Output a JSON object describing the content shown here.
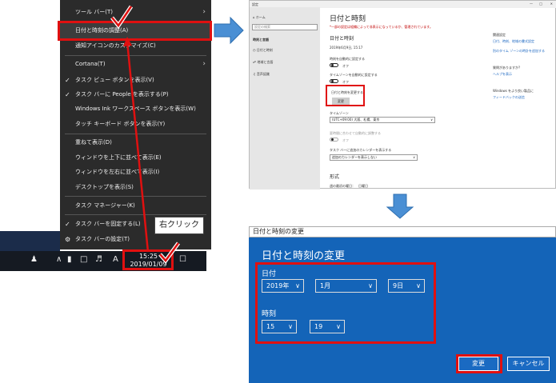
{
  "context_menu": {
    "items": [
      {
        "label": "ツール バー(T)",
        "arrow": "›"
      },
      {
        "label": "日付と時刻の調整(A)"
      },
      {
        "label": "通知アイコンのカスタマイズ(C)"
      },
      {
        "label": "Cortana(T)",
        "arrow": "›"
      },
      {
        "label": "タスク ビュー ボタンを表示(V)",
        "check": "✓"
      },
      {
        "label": "タスク バーに People を表示する(P)",
        "check": "✓"
      },
      {
        "label": "Windows Ink ワークスペース ボタンを表示(W)"
      },
      {
        "label": "タッチ キーボード ボタンを表示(Y)"
      },
      {
        "label": "重ねて表示(D)"
      },
      {
        "label": "ウィンドウを上下に並べて表示(E)"
      },
      {
        "label": "ウィンドウを左右に並べて表示(I)"
      },
      {
        "label": "デスクトップを表示(S)"
      },
      {
        "label": "タスク マネージャー(K)"
      },
      {
        "label": "タスク バーを固定する(L)",
        "check": "✓"
      },
      {
        "label": "タスク バーの設定(T)",
        "check": "⚙"
      }
    ]
  },
  "taskbar": {
    "time": "15:25",
    "date": "2019/01/09",
    "ime": "A"
  },
  "callout": {
    "label": "右クリック"
  },
  "settings": {
    "window_label": "設定",
    "search_placeholder": "設定の検索",
    "sidebar": {
      "home": "ホーム",
      "section": "時刻と言語",
      "items": [
        "日付と時刻",
        "地域と言語",
        "音声認識"
      ]
    },
    "title": "日付と時刻",
    "warning": "*一部の設定は組織によって非表示になっているか、管理されています。",
    "section_title": "日付と時刻",
    "current": "2019年6月9日, 15:17",
    "auto_time_label": "時刻を自動的に設定する",
    "auto_time_state": "オフ",
    "auto_tz_label": "タイムゾーンを自動的に設定する",
    "auto_tz_state": "オフ",
    "change_label": "日付と時刻を変更する",
    "change_button": "変更",
    "tz_label": "タイムゾーン",
    "tz_value": "(UTC+09:00) 大阪、札幌、東京",
    "dst_label": "夏時間に合わせて自動的に調整する",
    "dst_state": "オフ",
    "cal_label": "タスク バーに追加のカレンダーを表示する",
    "cal_value": "追加のカレンダーを表示しない",
    "format_title": "形式",
    "format_first": "週の最初の曜日：　日曜日",
    "related_title": "関連設定",
    "related_1": "日付、時刻、地域の書式設定",
    "related_2": "別のタイム ゾーンの時計を追加する",
    "question_title": "質問がありますか?",
    "question_link": "ヘルプを表示",
    "feedback_title": "Windows をより良い製品に",
    "feedback_link": "フィードバックの送信"
  },
  "dialog": {
    "titlebar": "日付と時刻の変更",
    "heading": "日付と時刻の変更",
    "date_label": "日付",
    "year": "2019年",
    "month": "1月",
    "day": "9日",
    "time_label": "時刻",
    "hour": "15",
    "minute": "19",
    "change_button": "変更",
    "cancel_button": "キャンセル"
  },
  "colors": {
    "accent_red": "#e01010",
    "dialog_blue": "#1464b8",
    "arrow_blue": "#4a8fd4",
    "menu_bg": "#2b2b2b"
  }
}
